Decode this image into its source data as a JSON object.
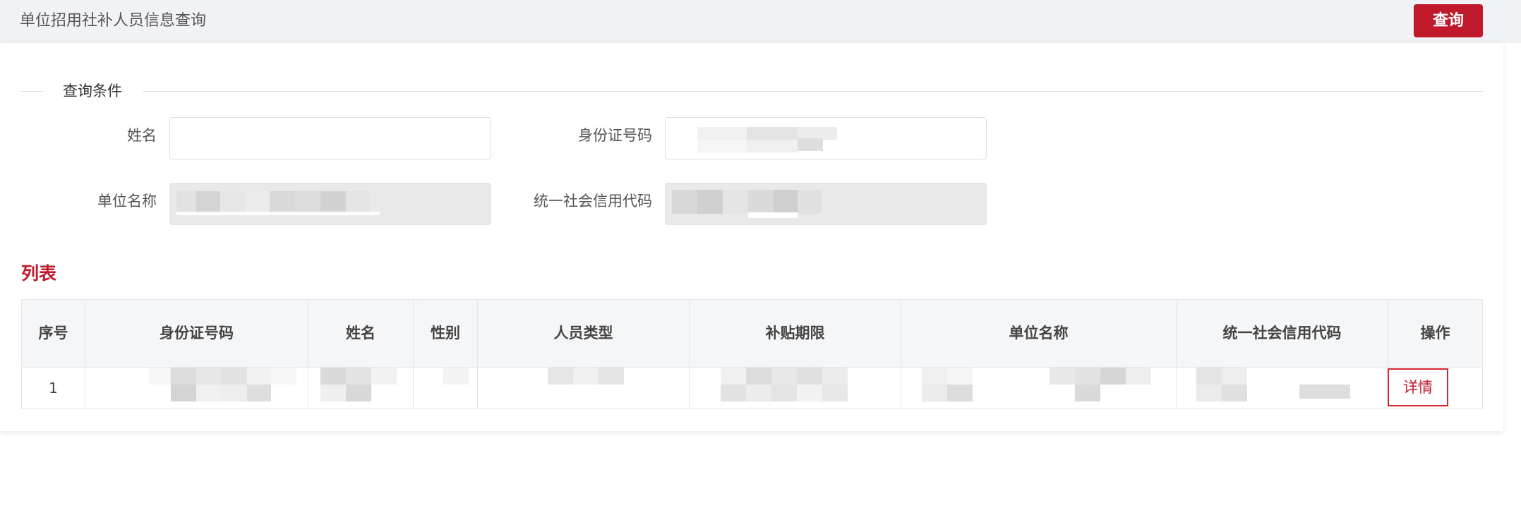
{
  "header": {
    "title": "单位招用社补人员信息查询",
    "query_label": "查询"
  },
  "conditions": {
    "legend": "查询条件",
    "name_label": "姓名",
    "name_value": "",
    "id_label": "身份证号码",
    "id_value": "",
    "unit_label": "单位名称",
    "unit_value": "",
    "credit_label": "统一社会信用代码",
    "credit_value": ""
  },
  "list": {
    "title": "列表",
    "columns": [
      "序号",
      "身份证号码",
      "姓名",
      "性别",
      "人员类型",
      "补贴期限",
      "单位名称",
      "统一社会信用代码",
      "操作"
    ],
    "rows": [
      {
        "index": "1",
        "id": "",
        "name": "",
        "gender": "",
        "type": "",
        "period": "",
        "unit": "",
        "credit": "",
        "action": "详情"
      }
    ]
  },
  "colors": {
    "accent": "#c0192b",
    "header_bg": "#f1f2f5",
    "table_head_bg": "#f5f6f8",
    "disabled_input_bg": "#e9e9e9"
  }
}
